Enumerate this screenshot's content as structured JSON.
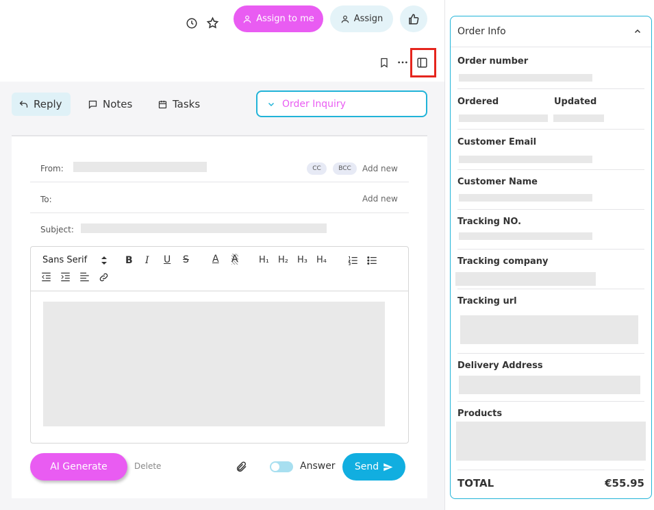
{
  "header": {
    "assign_to_me_label": "Assign to me",
    "assign_label": "Assign"
  },
  "tabs": {
    "reply": "Reply",
    "notes": "Notes",
    "tasks": "Tasks"
  },
  "category": {
    "value": "Order Inquiry"
  },
  "composer": {
    "from_label": "From:",
    "to_label": "To:",
    "subject_label": "Subject:",
    "cc_label": "CC",
    "bcc_label": "BCC",
    "add_new_label": "Add new",
    "font_family": "Sans Serif"
  },
  "footer": {
    "ai_generate_label": "AI Generate",
    "delete_label": "Delete",
    "answer_label": "Answer",
    "send_label": "Send"
  },
  "order_info": {
    "title": "Order Info",
    "order_number_label": "Order number",
    "ordered_label": "Ordered",
    "updated_label": "Updated",
    "customer_email_label": "Customer Email",
    "customer_name_label": "Customer Name",
    "tracking_no_label": "Tracking NO.",
    "tracking_company_label": "Tracking company",
    "tracking_url_label": "Tracking url",
    "delivery_address_label": "Delivery Address",
    "products_label": "Products",
    "total_label": "TOTAL",
    "total_value": "€55.95"
  },
  "colors": {
    "accent_pink": "#e95cf2",
    "accent_blue": "#11aee0",
    "panel_border": "#20b3d8",
    "highlight_red": "#e5251d"
  }
}
